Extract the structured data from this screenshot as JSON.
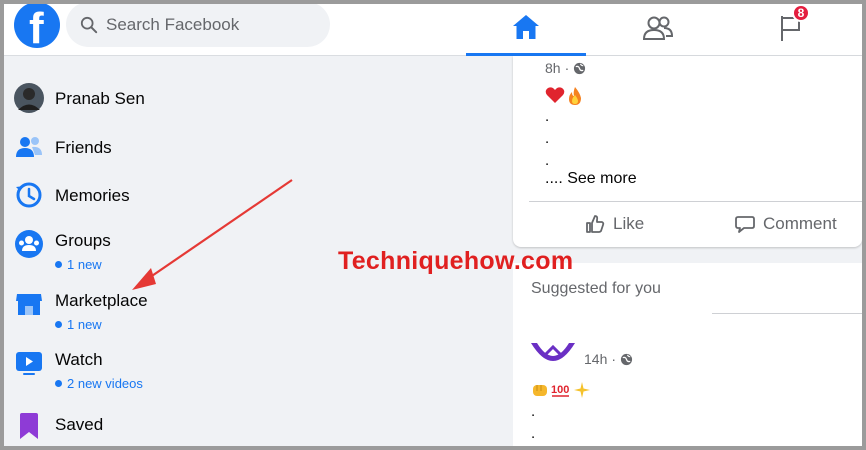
{
  "topbar": {
    "search_placeholder": "Search Facebook",
    "logo_letter": "f",
    "notification_count": "8",
    "accent_color": "#1877f2"
  },
  "sidebar": {
    "items": [
      {
        "label": "Pranab Sen",
        "icon": "avatar"
      },
      {
        "label": "Friends",
        "icon": "friends-icon"
      },
      {
        "label": "Memories",
        "icon": "memories-icon"
      },
      {
        "label": "Groups",
        "icon": "groups-icon",
        "sub": "1 new"
      },
      {
        "label": "Marketplace",
        "icon": "marketplace-icon",
        "sub": "1 new"
      },
      {
        "label": "Watch",
        "icon": "watch-icon",
        "sub": "2 new videos"
      },
      {
        "label": "Saved",
        "icon": "saved-icon"
      }
    ]
  },
  "feed": {
    "post1": {
      "time": "8h",
      "dots": [
        ".",
        ".",
        "."
      ],
      "see_more_prefix": "....",
      "see_more": "See more",
      "like": "Like",
      "comment": "Comment"
    },
    "suggested_title": "Suggested for you",
    "post2": {
      "time": "14h",
      "dots": [
        ".",
        "."
      ]
    }
  },
  "watermark": "Techniquehow.com"
}
